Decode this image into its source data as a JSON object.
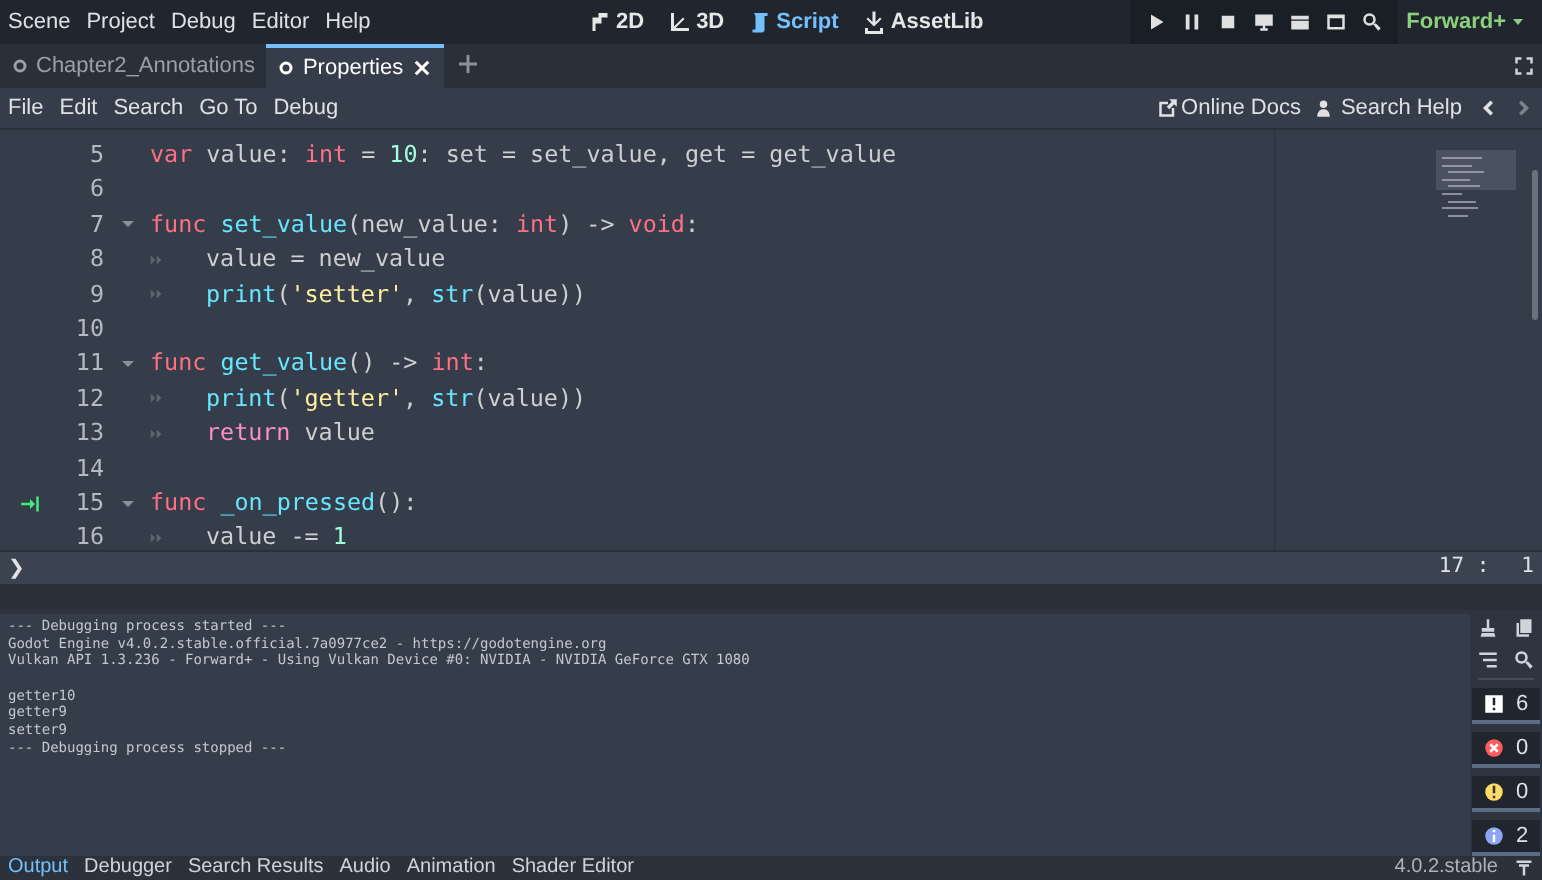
{
  "menu": [
    "Scene",
    "Project",
    "Debug",
    "Editor",
    "Help"
  ],
  "workspaces": [
    {
      "label": "2D",
      "kind": "planar",
      "selected": false
    },
    {
      "label": "3D",
      "kind": "spatial",
      "selected": false
    },
    {
      "label": "Script",
      "kind": "script",
      "selected": true
    },
    {
      "label": "AssetLib",
      "kind": "assetlib",
      "selected": false
    }
  ],
  "renderer": "Forward+",
  "script_tabs": [
    {
      "label": "Chapter2_Annotations",
      "selected": false
    },
    {
      "label": "Properties",
      "selected": true
    }
  ],
  "script_menu": [
    "File",
    "Edit",
    "Search",
    "Go To",
    "Debug"
  ],
  "help_links": [
    "Online Docs",
    "Search Help"
  ],
  "lines": [
    {
      "number": "5",
      "fold": false,
      "tab": false,
      "signal": false,
      "tokens": [
        {
          "text": "var",
          "kind": "keyword"
        },
        {
          "text": " value: ",
          "kind": "text"
        },
        {
          "text": "int",
          "kind": "keyword"
        },
        {
          "text": " = ",
          "kind": "text"
        },
        {
          "text": "10",
          "kind": "number"
        },
        {
          "text": ": set = set_value, get = get_value",
          "kind": "text"
        }
      ]
    },
    {
      "number": "6",
      "fold": false,
      "tab": false,
      "signal": false
    },
    {
      "number": "7",
      "fold": true,
      "tab": false,
      "signal": false,
      "tokens": [
        {
          "text": "func",
          "kind": "keyword"
        },
        {
          "text": " set_value",
          "kind": "function"
        },
        {
          "text": "(new_value: ",
          "kind": "text"
        },
        {
          "text": "int",
          "kind": "keyword"
        },
        {
          "text": ") -> ",
          "kind": "text"
        },
        {
          "text": "void",
          "kind": "keyword"
        },
        {
          "text": ":",
          "kind": "text"
        }
      ]
    },
    {
      "number": "8",
      "fold": false,
      "tab": true,
      "signal": false,
      "tokens": [
        {
          "text": "value = new_value",
          "kind": "text"
        }
      ]
    },
    {
      "number": "9",
      "fold": false,
      "tab": true,
      "signal": false,
      "tokens": [
        {
          "text": "print",
          "kind": "function"
        },
        {
          "text": "(",
          "kind": "text"
        },
        {
          "text": "'setter'",
          "kind": "string"
        },
        {
          "text": ", ",
          "kind": "text"
        },
        {
          "text": "str",
          "kind": "function"
        },
        {
          "text": "(value))",
          "kind": "text"
        }
      ]
    },
    {
      "number": "10",
      "fold": false,
      "tab": false,
      "signal": false
    },
    {
      "number": "11",
      "fold": true,
      "tab": false,
      "signal": false,
      "tokens": [
        {
          "text": "func",
          "kind": "keyword"
        },
        {
          "text": " get_value",
          "kind": "function"
        },
        {
          "text": "() -> ",
          "kind": "text"
        },
        {
          "text": "int",
          "kind": "keyword"
        },
        {
          "text": ":",
          "kind": "text"
        }
      ]
    },
    {
      "number": "12",
      "fold": false,
      "tab": true,
      "signal": false,
      "tokens": [
        {
          "text": "print",
          "kind": "function"
        },
        {
          "text": "(",
          "kind": "text"
        },
        {
          "text": "'getter'",
          "kind": "string"
        },
        {
          "text": ", ",
          "kind": "text"
        },
        {
          "text": "str",
          "kind": "function"
        },
        {
          "text": "(value))",
          "kind": "text"
        }
      ]
    },
    {
      "number": "13",
      "fold": false,
      "tab": true,
      "signal": false,
      "tokens": [
        {
          "text": "return",
          "kind": "control"
        },
        {
          "text": " value",
          "kind": "text"
        }
      ]
    },
    {
      "number": "14",
      "fold": false,
      "tab": false,
      "signal": false
    },
    {
      "number": "15",
      "fold": true,
      "tab": false,
      "signal": true,
      "tokens": [
        {
          "text": "func",
          "kind": "keyword"
        },
        {
          "text": " _on_pressed",
          "kind": "function"
        },
        {
          "text": "():",
          "kind": "text"
        }
      ]
    },
    {
      "number": "16",
      "fold": false,
      "tab": true,
      "signal": false,
      "tokens": [
        {
          "text": "value -= ",
          "kind": "text"
        },
        {
          "text": "1",
          "kind": "number"
        }
      ]
    }
  ],
  "status": {
    "toggle": "❯",
    "position": "17 :",
    "column": "1"
  },
  "output": [
    [
      "--- Debugging process started ---",
      "Godot Engine v4.0.2.stable.official.7a0977ce2 - https://godotengine.org",
      "Vulkan API 1.3.236 - Forward+ - Using Vulkan Device #0: NVIDIA - NVIDIA GeForce GTX 1080"
    ],
    [
      "getter10",
      "getter9",
      "setter9",
      "--- Debugging process stopped ---"
    ]
  ],
  "filters": [
    {
      "kind": "message",
      "count": "6",
      "selected": true
    },
    {
      "kind": "error",
      "count": "0",
      "selected": true
    },
    {
      "kind": "warning",
      "count": "0",
      "selected": true
    },
    {
      "kind": "editor",
      "count": "2",
      "selected": true
    }
  ],
  "bottom_tabs": [
    {
      "label": "Output",
      "selected": true
    },
    {
      "label": "Debugger",
      "selected": false
    },
    {
      "label": "Search Results",
      "selected": false
    },
    {
      "label": "Audio",
      "selected": false
    },
    {
      "label": "Animation",
      "selected": false
    },
    {
      "label": "Shader Editor",
      "selected": false
    }
  ],
  "version": "4.0.2.stable"
}
